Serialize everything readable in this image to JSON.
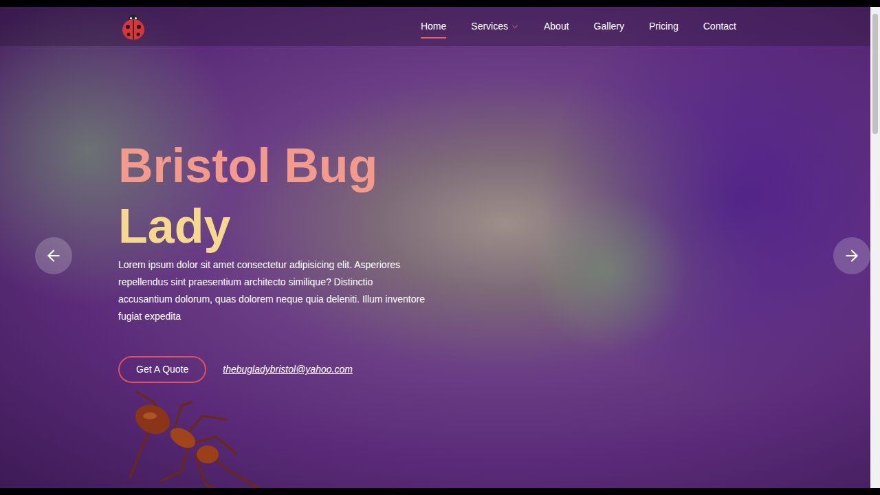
{
  "nav": {
    "items": [
      {
        "label": "Home",
        "selected": true,
        "dropdown": false
      },
      {
        "label": "Services",
        "selected": false,
        "dropdown": true
      },
      {
        "label": "About",
        "selected": false,
        "dropdown": false
      },
      {
        "label": "Gallery",
        "selected": false,
        "dropdown": false
      },
      {
        "label": "Pricing",
        "selected": false,
        "dropdown": false
      },
      {
        "label": "Contact",
        "selected": false,
        "dropdown": false
      }
    ]
  },
  "hero": {
    "title_lines": [
      {
        "text": "Bristol Bug",
        "color": "#f29a8c"
      },
      {
        "text": "Lady",
        "color": "#f6d88e"
      }
    ],
    "description": "Lorem ipsum dolor sit amet consectetur adipisicing elit. Asperiores repellendus sint praesentium architecto similique? Distinctio accusantium dolorum, quas dolorem neque quia deleniti. Illum inventore fugiat expedita",
    "quote_button": "Get A Quote",
    "email": "thebugladybristol@yahoo.com"
  },
  "scrollbar": {
    "level": 0.25
  }
}
